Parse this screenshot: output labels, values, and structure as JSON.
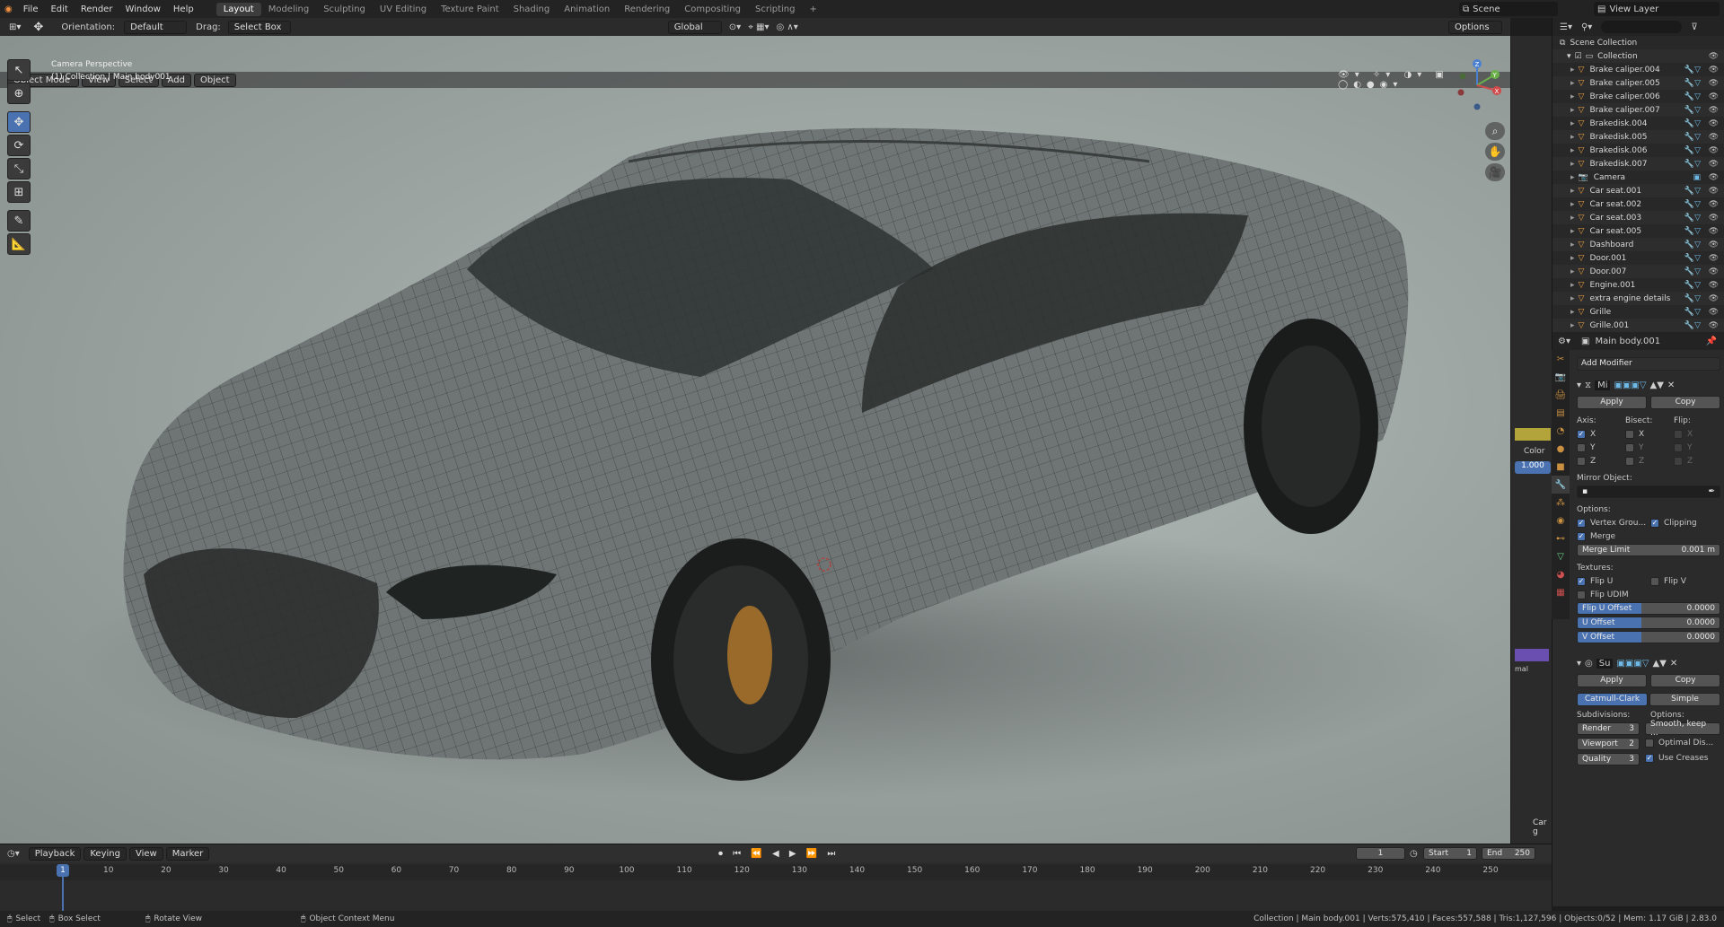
{
  "menu": [
    "File",
    "Edit",
    "Render",
    "Window",
    "Help"
  ],
  "workspaces": [
    {
      "label": "Layout",
      "active": true
    },
    {
      "label": "Modeling"
    },
    {
      "label": "Sculpting"
    },
    {
      "label": "UV Editing"
    },
    {
      "label": "Texture Paint"
    },
    {
      "label": "Shading"
    },
    {
      "label": "Animation"
    },
    {
      "label": "Rendering"
    },
    {
      "label": "Compositing"
    },
    {
      "label": "Scripting"
    },
    {
      "label": "+"
    }
  ],
  "scene": {
    "scene_label": "Scene",
    "view_layer_label": "View Layer"
  },
  "header3d": {
    "orientation_label": "Orientation:",
    "orientation_value": "Default",
    "drag_label": "Drag:",
    "drag_value": "Select Box",
    "transform_space": "Global",
    "options_label": "Options"
  },
  "viewport_header": {
    "mode": "Object Mode",
    "menus": [
      "View",
      "Select",
      "Add",
      "Object"
    ]
  },
  "viewport": {
    "perspective": "Camera Perspective",
    "active_object": "(1) Collection | Main body001"
  },
  "gizmo": {
    "axes": [
      "Z",
      "Y",
      "X"
    ]
  },
  "outliner": {
    "scene_collection": "Scene Collection",
    "collection": "Collection",
    "items": [
      "Brake caliper.004",
      "Brake caliper.005",
      "Brake caliper.006",
      "Brake caliper.007",
      "Brakedisk.004",
      "Brakedisk.005",
      "Brakedisk.006",
      "Brakedisk.007",
      "Camera",
      "Car seat.001",
      "Car seat.002",
      "Car seat.003",
      "Car seat.005",
      "Dashboard",
      "Door.001",
      "Door.007",
      "Engine.001",
      "extra engine details",
      "Grille",
      "Grille.001"
    ]
  },
  "properties": {
    "object_name": "Main body.001",
    "add_modifier": "Add Modifier",
    "mirror": {
      "name": "Mi",
      "apply": "Apply",
      "copy": "Copy",
      "axis_label": "Axis:",
      "bisect_label": "Bisect:",
      "flip_label": "Flip:",
      "axes": [
        "X",
        "Y",
        "Z"
      ],
      "mirror_object_label": "Mirror Object:",
      "options_label": "Options:",
      "vertex_groups": "Vertex Grou...",
      "clipping": "Clipping",
      "merge": "Merge",
      "merge_limit_label": "Merge Limit",
      "merge_limit_value": "0.001 m",
      "textures_label": "Textures:",
      "flip_u": "Flip U",
      "flip_v": "Flip V",
      "flip_udim": "Flip UDIM",
      "flip_u_offset": "Flip U Offset",
      "flip_u_offset_value": "0.0000",
      "u_offset": "U Offset",
      "u_offset_value": "0.0000",
      "v_offset": "V Offset",
      "v_offset_value": "0.0000"
    },
    "subsurf": {
      "name": "Su",
      "apply": "Apply",
      "copy": "Copy",
      "catmull": "Catmull-Clark",
      "simple": "Simple",
      "subdivisions_label": "Subdivisions:",
      "options_label": "Options:",
      "render_label": "Render",
      "render_value": "3",
      "viewport_label": "Viewport",
      "viewport_value": "2",
      "quality_label": "Quality",
      "quality_value": "3",
      "uv_smooth": "Smooth, keep ...",
      "optimal_display": "Optimal Dis...",
      "use_creases": "Use Creases"
    }
  },
  "hidden_panel": {
    "color_label": "Color",
    "color_value": "1.000",
    "mal": "mal",
    "car_label": "Car g"
  },
  "timeline": {
    "menus": [
      "Playback",
      "Keying",
      "View",
      "Marker"
    ],
    "current_frame": "1",
    "start_label": "Start",
    "start_value": "1",
    "end_label": "End",
    "end_value": "250",
    "ticks": [
      "1",
      "10",
      "20",
      "30",
      "40",
      "50",
      "60",
      "70",
      "80",
      "90",
      "100",
      "110",
      "120",
      "130",
      "140",
      "150",
      "160",
      "170",
      "180",
      "190",
      "200",
      "210",
      "220",
      "230",
      "240",
      "250"
    ]
  },
  "statusbar": {
    "select": "Select",
    "box_select": "Box Select",
    "rotate_view": "Rotate View",
    "context_menu": "Object Context Menu",
    "stats": "Collection | Main body.001 | Verts:575,410 | Faces:557,588 | Tris:1,127,596 | Objects:0/52 | Mem: 1.17 GiB | 2.83.0"
  }
}
